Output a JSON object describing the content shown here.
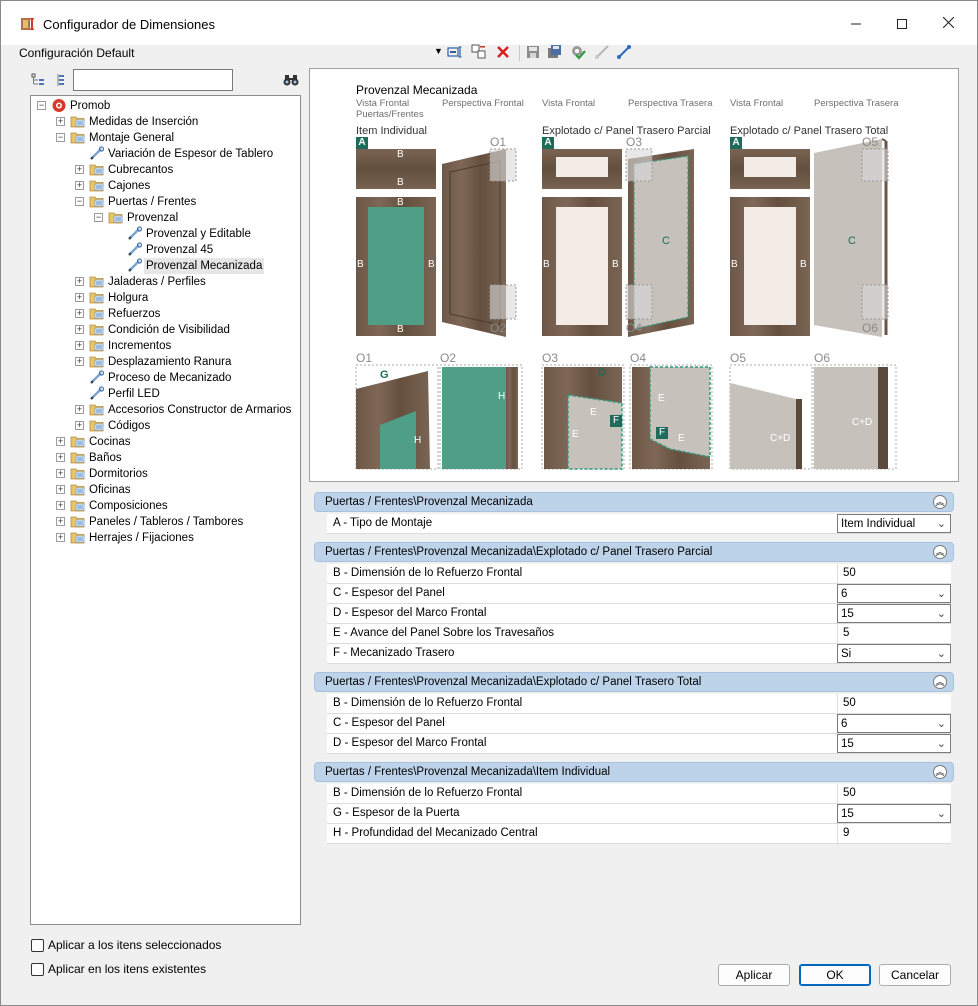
{
  "window": {
    "title": "Configurador de Dimensiones"
  },
  "configuration": {
    "label": "Configuración Default"
  },
  "tree": [
    {
      "label": "Promob",
      "level": 0,
      "expander": "−",
      "icon": "promob"
    },
    {
      "label": "Medidas de Inserción",
      "level": 1,
      "expander": "+",
      "icon": "folder"
    },
    {
      "label": "Montaje General",
      "level": 1,
      "expander": "−",
      "icon": "folder"
    },
    {
      "label": "Variación de Espesor de Tablero",
      "level": 2,
      "expander": "",
      "icon": "tool"
    },
    {
      "label": "Cubrecantos",
      "level": 2,
      "expander": "+",
      "icon": "folder"
    },
    {
      "label": "Cajones",
      "level": 2,
      "expander": "+",
      "icon": "folder"
    },
    {
      "label": "Puertas / Frentes",
      "level": 2,
      "expander": "−",
      "icon": "folder"
    },
    {
      "label": "Provenzal",
      "level": 3,
      "expander": "−",
      "icon": "folder"
    },
    {
      "label": "Provenzal y Editable",
      "level": 4,
      "expander": "",
      "icon": "tool"
    },
    {
      "label": "Provenzal 45",
      "level": 4,
      "expander": "",
      "icon": "tool"
    },
    {
      "label": "Provenzal Mecanizada",
      "level": 4,
      "expander": "",
      "icon": "tool",
      "selected": true
    },
    {
      "label": "Jaladeras / Perfiles",
      "level": 2,
      "expander": "+",
      "icon": "folder"
    },
    {
      "label": "Holgura",
      "level": 2,
      "expander": "+",
      "icon": "folder"
    },
    {
      "label": "Refuerzos",
      "level": 2,
      "expander": "+",
      "icon": "folder"
    },
    {
      "label": "Condición de Visibilidad",
      "level": 2,
      "expander": "+",
      "icon": "folder"
    },
    {
      "label": "Incrementos",
      "level": 2,
      "expander": "+",
      "icon": "folder"
    },
    {
      "label": "Desplazamiento Ranura",
      "level": 2,
      "expander": "+",
      "icon": "folder"
    },
    {
      "label": "Proceso de Mecanizado",
      "level": 2,
      "expander": "",
      "icon": "tool"
    },
    {
      "label": "Perfil LED",
      "level": 2,
      "expander": "",
      "icon": "tool"
    },
    {
      "label": "Accesorios Constructor de Armarios",
      "level": 2,
      "expander": "+",
      "icon": "folder"
    },
    {
      "label": "Códigos",
      "level": 2,
      "expander": "+",
      "icon": "folder"
    },
    {
      "label": "Cocinas",
      "level": 1,
      "expander": "+",
      "icon": "folder"
    },
    {
      "label": "Baños",
      "level": 1,
      "expander": "+",
      "icon": "folder"
    },
    {
      "label": "Dormitorios",
      "level": 1,
      "expander": "+",
      "icon": "folder"
    },
    {
      "label": "Oficinas",
      "level": 1,
      "expander": "+",
      "icon": "folder"
    },
    {
      "label": "Composiciones",
      "level": 1,
      "expander": "+",
      "icon": "folder"
    },
    {
      "label": "Paneles / Tableros / Tambores",
      "level": 1,
      "expander": "+",
      "icon": "folder"
    },
    {
      "label": "Herrajes / Fijaciones",
      "level": 1,
      "expander": "+",
      "icon": "folder"
    }
  ],
  "preview": {
    "title": "Provenzal Mecanizada",
    "view_labels": [
      "Vista Frontal",
      "Perspectiva Frontal",
      "Vista Frontal",
      "Perspectiva Trasera",
      "Vista Frontal",
      "Perspectiva Trasera"
    ],
    "sub_label": "Puertas/Frentes",
    "groups": [
      "Item Individual",
      "Explotado c/ Panel Trasero Parcial",
      "Explotado c/ Panel Trasero Total"
    ],
    "detail_labels": [
      "O1",
      "O2",
      "O3",
      "O4",
      "O5",
      "O6"
    ],
    "callouts": {
      "A": "A",
      "B": "B",
      "C": "C",
      "D": "D",
      "E": "E",
      "F": "F",
      "G": "G",
      "H": "H",
      "CD": "C+D"
    }
  },
  "sections": [
    {
      "title": "Puertas / Frentes\\Provenzal Mecanizada",
      "rows": [
        {
          "label": "A - Tipo de Montaje",
          "value": "Item Individual",
          "dropdown": true
        }
      ]
    },
    {
      "title": "Puertas / Frentes\\Provenzal Mecanizada\\Explotado c/ Panel Trasero Parcial",
      "rows": [
        {
          "label": "B - Dimensión de lo Refuerzo Frontal",
          "value": "50",
          "dropdown": false
        },
        {
          "label": "C - Espesor del Panel",
          "value": "6",
          "dropdown": true
        },
        {
          "label": "D - Espesor del Marco Frontal",
          "value": "15",
          "dropdown": true
        },
        {
          "label": "E - Avance del Panel Sobre los Travesaños",
          "value": "5",
          "dropdown": false
        },
        {
          "label": "F - Mecanizado Trasero",
          "value": "Si",
          "dropdown": true
        }
      ]
    },
    {
      "title": "Puertas / Frentes\\Provenzal Mecanizada\\Explotado c/ Panel Trasero Total",
      "rows": [
        {
          "label": "B - Dimensión de lo Refuerzo Frontal",
          "value": "50",
          "dropdown": false
        },
        {
          "label": "C - Espesor del Panel",
          "value": "6",
          "dropdown": true
        },
        {
          "label": "D - Espesor del Marco Frontal",
          "value": "15",
          "dropdown": true
        }
      ]
    },
    {
      "title": "Puertas / Frentes\\Provenzal Mecanizada\\Item Individual",
      "rows": [
        {
          "label": "B - Dimensión de lo Refuerzo Frontal",
          "value": "50",
          "dropdown": false
        },
        {
          "label": "G - Espesor de la Puerta",
          "value": "15",
          "dropdown": true
        },
        {
          "label": "H - Profundidad del Mecanizado Central",
          "value": "9",
          "dropdown": false
        }
      ]
    }
  ],
  "options": {
    "apply_selected": "Aplicar a los itens seleccionados",
    "apply_existing": "Aplicar en los itens existentes"
  },
  "buttons": {
    "apply": "Aplicar",
    "ok": "OK",
    "cancel": "Cancelar"
  },
  "colors": {
    "wood": "#6b5646",
    "panel_green": "#4f9e86",
    "panel_cream": "#f3ece6",
    "panel_gray": "#c6c1bb",
    "section_header": "#bdd3ea"
  }
}
